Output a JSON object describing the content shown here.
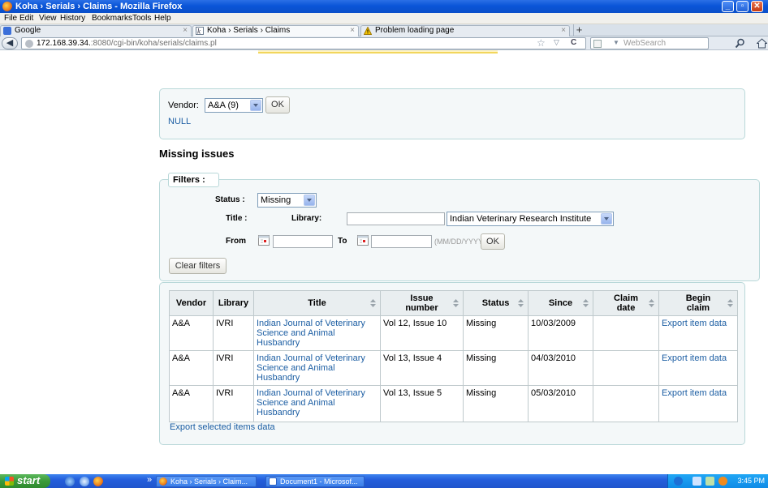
{
  "window": {
    "title": "Koha › Serials › Claims - Mozilla Firefox"
  },
  "menu": {
    "items": [
      "File",
      "Edit",
      "View",
      "History",
      "Bookmarks",
      "Tools",
      "Help"
    ]
  },
  "tabs": {
    "items": [
      {
        "label": "Google"
      },
      {
        "label": "Koha › Serials › Claims"
      },
      {
        "label": "Problem loading page"
      }
    ],
    "close_glyph": "×",
    "new_tab_glyph": "+"
  },
  "nav": {
    "url_host": "172.168.39.34.",
    "url_path": ":8080/cgi-bin/koha/serials/claims.pl",
    "search_placeholder": "WebSearch"
  },
  "vendor_form": {
    "label": "Vendor:",
    "selected": "A&A (9)",
    "ok_label": "OK",
    "null_link": "NULL"
  },
  "section_heading": "Missing issues",
  "filters": {
    "legend": "Filters :",
    "status_label": "Status :",
    "status_selected": "Missing",
    "title_label": "Title :",
    "library_label": "Library:",
    "title_value": "",
    "library_selected": "Indian Veterinary Research Institute",
    "from_label": "From",
    "to_label": "To",
    "from_value": "",
    "to_value": "",
    "date_format_hint": "(MM/DD/YYYY)",
    "ok_label": "OK",
    "clear_label": "Clear filters"
  },
  "table": {
    "headers": [
      {
        "label": "Vendor",
        "sortable": false
      },
      {
        "label": "Library",
        "sortable": false
      },
      {
        "label": "Title",
        "sortable": true
      },
      {
        "label": "Issue number",
        "sortable": true
      },
      {
        "label": "Status",
        "sortable": true
      },
      {
        "label": "Since",
        "sortable": true
      },
      {
        "label": "Claim date",
        "sortable": true
      },
      {
        "label": "Begin claim",
        "sortable": true
      }
    ],
    "rows": [
      {
        "vendor": "A&A",
        "library": "IVRI",
        "title": "Indian Journal of Veterinary Science and Animal Husbandry",
        "issue": "Vol 12, Issue 10",
        "status": "Missing",
        "since": "10/03/2009",
        "claim_date": "",
        "action": "Export item data"
      },
      {
        "vendor": "A&A",
        "library": "IVRI",
        "title": "Indian Journal of Veterinary Science and Animal Husbandry",
        "issue": "Vol 13, Issue 4",
        "status": "Missing",
        "since": "04/03/2010",
        "claim_date": "",
        "action": "Export item data"
      },
      {
        "vendor": "A&A",
        "library": "IVRI",
        "title": "Indian Journal of Veterinary Science and Animal Husbandry",
        "issue": "Vol 13, Issue 5",
        "status": "Missing",
        "since": "05/03/2010",
        "claim_date": "",
        "action": "Export item data"
      }
    ]
  },
  "export_link": "Export selected items data",
  "taskbar": {
    "start_label": "start",
    "overflow_glyph": "»",
    "tasks": [
      "Koha › Serials › Claim...",
      "Document1 - Microsof..."
    ],
    "clock": "3:45 PM"
  },
  "colors": {
    "link": "#1c5ea3",
    "panel_bg": "#f4f8f9",
    "panel_border": "#b9d8d9",
    "xp_blue": "#245edb",
    "start_green": "#3a9a3a"
  },
  "icons": [
    "firefox-icon",
    "google-favicon",
    "koha-favicon",
    "warning-icon",
    "back-arrow-icon",
    "globe-icon",
    "bookmark-star-icon",
    "reload-icon",
    "search-icon",
    "home-icon",
    "calendar-icon",
    "sort-icon",
    "windows-flag-icon"
  ]
}
